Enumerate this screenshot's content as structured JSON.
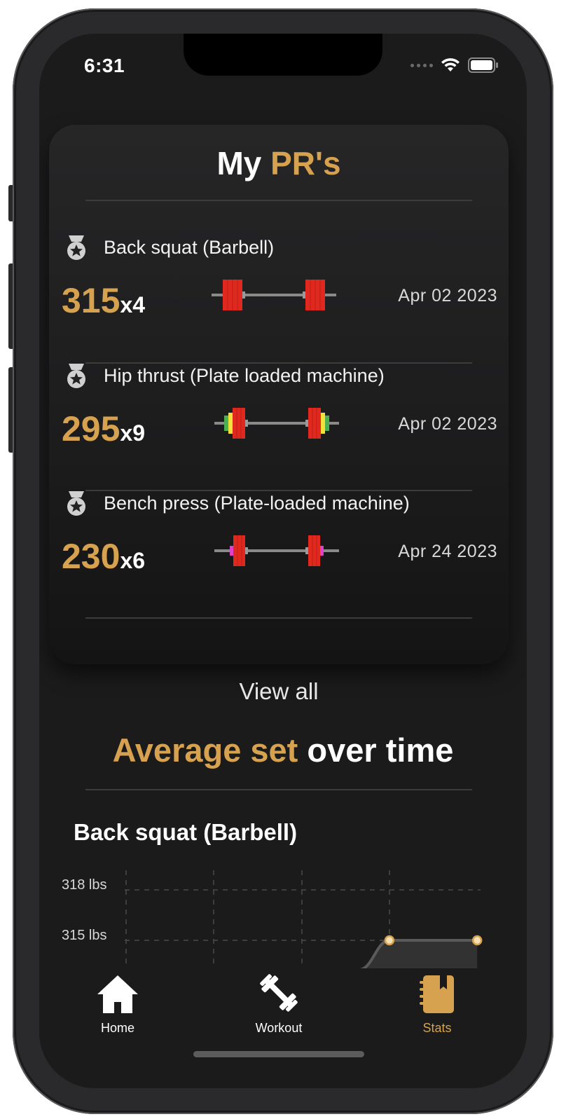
{
  "status_bar": {
    "time": "6:31"
  },
  "pr_card": {
    "title_part1": "My",
    "title_part2": "PR's",
    "items": [
      {
        "exercise": "Back squat (Barbell)",
        "weight": "315",
        "reps": "x4",
        "date": "Apr 02 2023"
      },
      {
        "exercise": "Hip thrust (Plate loaded machine)",
        "weight": "295",
        "reps": "x9",
        "date": "Apr 02 2023"
      },
      {
        "exercise": "Bench press (Plate-loaded machine)",
        "weight": "230",
        "reps": "x6",
        "date": "Apr 24 2023"
      }
    ],
    "view_all_label": "View all"
  },
  "average_section": {
    "title_part1": "Average set",
    "title_part2": "over time",
    "exercise": "Back squat (Barbell)"
  },
  "chart_data": {
    "type": "area",
    "y_tick_labels": [
      "318 lbs",
      "315 lbs"
    ],
    "y_ticks": [
      318,
      315
    ],
    "series": [
      {
        "points": [
          [
            3,
            315
          ],
          [
            4,
            315
          ]
        ]
      }
    ],
    "grid": true
  },
  "tabs": [
    {
      "label": "Home",
      "icon": "home-icon",
      "active": false
    },
    {
      "label": "Workout",
      "icon": "dumbbell-icon",
      "active": false
    },
    {
      "label": "Stats",
      "icon": "notebook-icon",
      "active": true
    }
  ],
  "colors": {
    "accent": "#d6a24f",
    "background": "#1b1b1c",
    "plate_red": "#e0281f",
    "plate_yellow": "#f4e03a",
    "plate_green": "#4caf50",
    "plate_magenta": "#e040c8"
  }
}
